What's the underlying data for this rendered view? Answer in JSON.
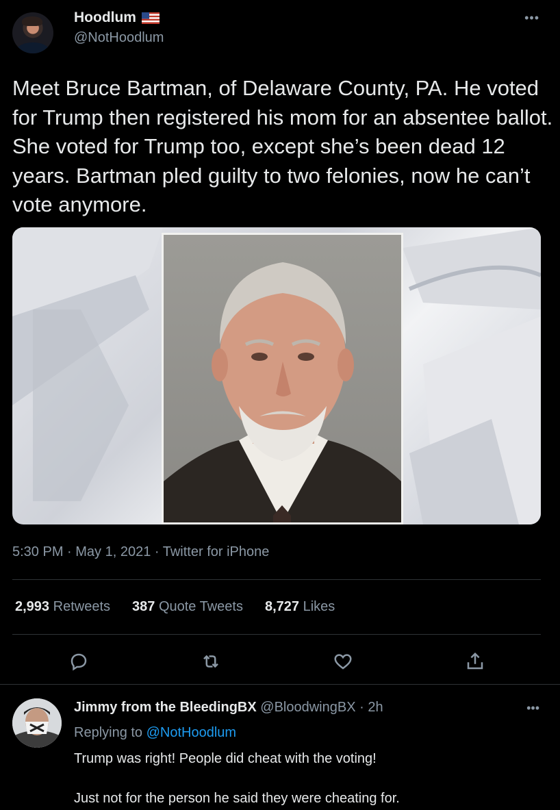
{
  "tweet": {
    "author_name": "Hoodlum",
    "author_handle": "@NotHoodlum",
    "more_icon": "ellipsis-icon",
    "text": "Meet Bruce Bartman, of Delaware County, PA. He voted for Trump then registered his mom for an absentee ballot. She voted for Trump too, except she’s been dead 12 years. Bartman pled guilty to two felonies, now he can’t vote anymore.",
    "timestamp": "5:30 PM · May 1, 2021 · Twitter for iPhone",
    "stats": {
      "retweets_count": "2,993",
      "retweets_label": "Retweets",
      "quotes_count": "387",
      "quotes_label": "Quote Tweets",
      "likes_count": "8,727",
      "likes_label": "Likes"
    },
    "actions": [
      "reply-icon",
      "retweet-icon",
      "like-icon",
      "share-icon"
    ]
  },
  "reply": {
    "author_name": "Jimmy from the BleedingBX",
    "author_handle": "@BloodwingBX",
    "time": "· 2h",
    "replying_label": "Replying to",
    "replying_to": "@NotHoodlum",
    "text": "Trump was right! People did cheat with the voting!\n\nJust not for the person he said they were cheating for."
  },
  "colors": {
    "background": "#000000",
    "text_primary": "#e7e9ea",
    "text_secondary": "#8b98a5",
    "link": "#1d9bf0",
    "divider": "#2f3336"
  }
}
